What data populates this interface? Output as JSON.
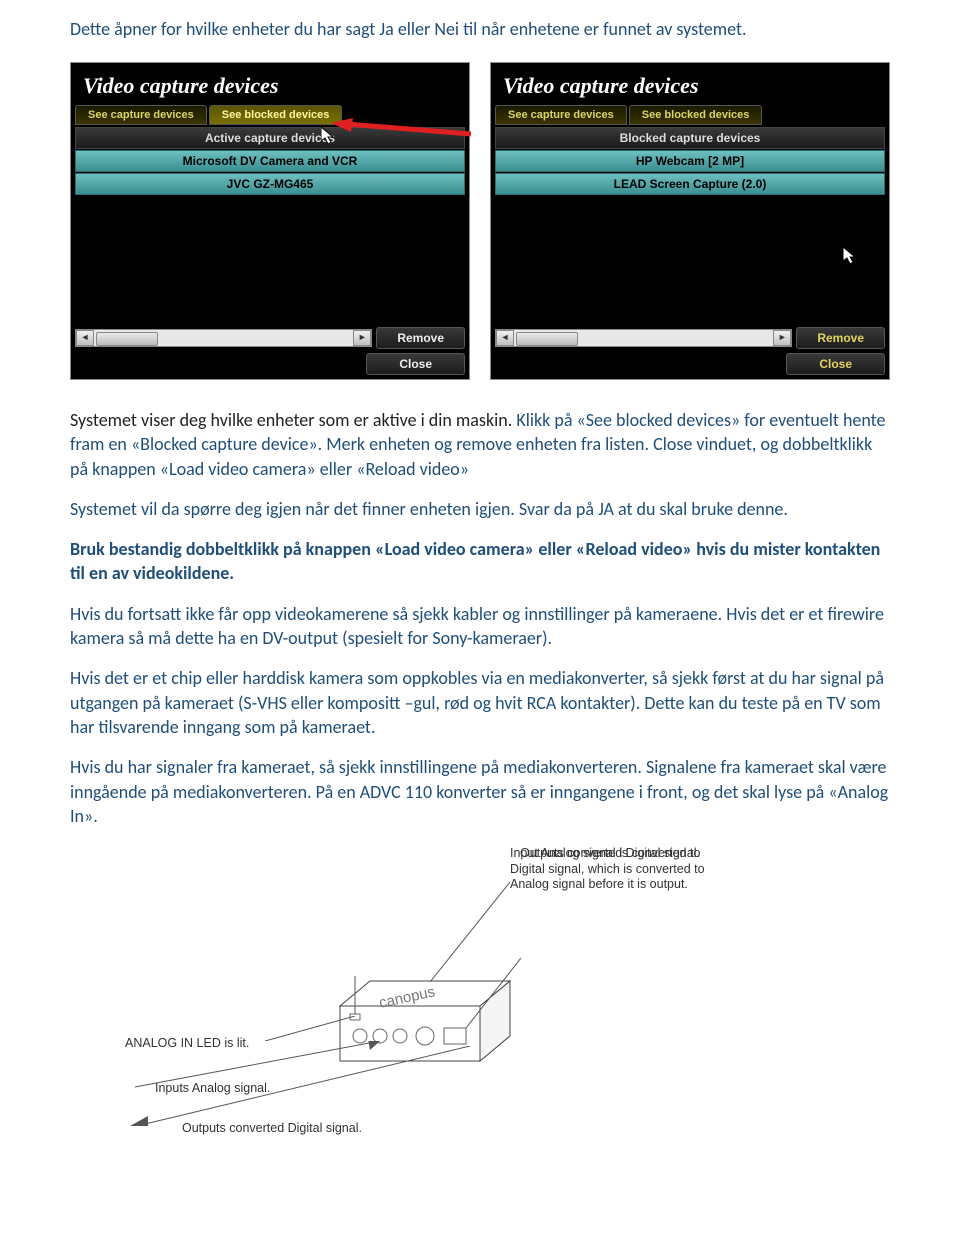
{
  "intro": "Dette åpner for hvilke enheter du har sagt Ja eller Nei til når enhetene er funnet av systemet.",
  "left_panel": {
    "title": "Video capture devices",
    "tab_see_capture": "See capture devices",
    "tab_see_blocked": "See blocked devices",
    "header": "Active capture devices",
    "device1": "Microsoft DV Camera and VCR",
    "device2": "JVC GZ-MG465",
    "btn_remove": "Remove",
    "btn_close": "Close"
  },
  "right_panel": {
    "title": "Video capture devices",
    "tab_see_capture": "See capture devices",
    "tab_see_blocked": "See blocked devices",
    "header": "Blocked capture devices",
    "device1": "HP Webcam [2 MP]",
    "device2": "LEAD Screen Capture (2.0)",
    "btn_remove": "Remove",
    "btn_close": "Close"
  },
  "para1_part1": "Systemet viser deg hvilke enheter som er aktive i din maskin.",
  "para1_part2": " Klikk på «See blocked devices» for eventuelt hente fram en «Blocked capture device». Merk enheten og remove enheten fra listen. Close vinduet, og dobbeltklikk på knappen «Load video camera» eller «Reload video»",
  "para2": "Systemet vil da spørre deg igjen når det finner enheten igjen. Svar da på JA at du skal bruke denne.",
  "para3": "Bruk bestandig dobbeltklikk på knappen «Load video camera» eller «Reload video» hvis du mister kontakten til en av videokildene.",
  "para4": "Hvis du fortsatt ikke får opp videokamerene så sjekk kabler og innstillinger på kameraene. Hvis det er et firewire kamera så må dette ha en DV-output (spesielt for Sony-kameraer).",
  "para5": "Hvis det er et chip eller harddisk kamera som oppkobles via en mediakonverter, så sjekk først at du har signal på utgangen på kameraet (S-VHS eller kompositt –gul, rød og hvit RCA kontakter). Dette kan du teste på en TV som har tilsvarende inngang som på kameraet.",
  "para6": "Hvis du har signaler fra kameraet, så sjekk innstillingene på mediakonverteren. Signalene fra kameraet skal være inngående på mediakonverteren. På en ADVC 110 konverter så er inngangene i front, og det skal lyse på «Analog In».",
  "diagram": {
    "brand": "canopus",
    "label_top": "Input Analog signal is converted to Digital signal, which is converted to Analog signal before it is output.",
    "label_mid": "Outputs converted Digital signal.",
    "label_analog_led": "ANALOG IN LED is lit.",
    "label_inputs": "Inputs Analog signal.",
    "label_outputs": "Outputs converted Digital signal."
  }
}
